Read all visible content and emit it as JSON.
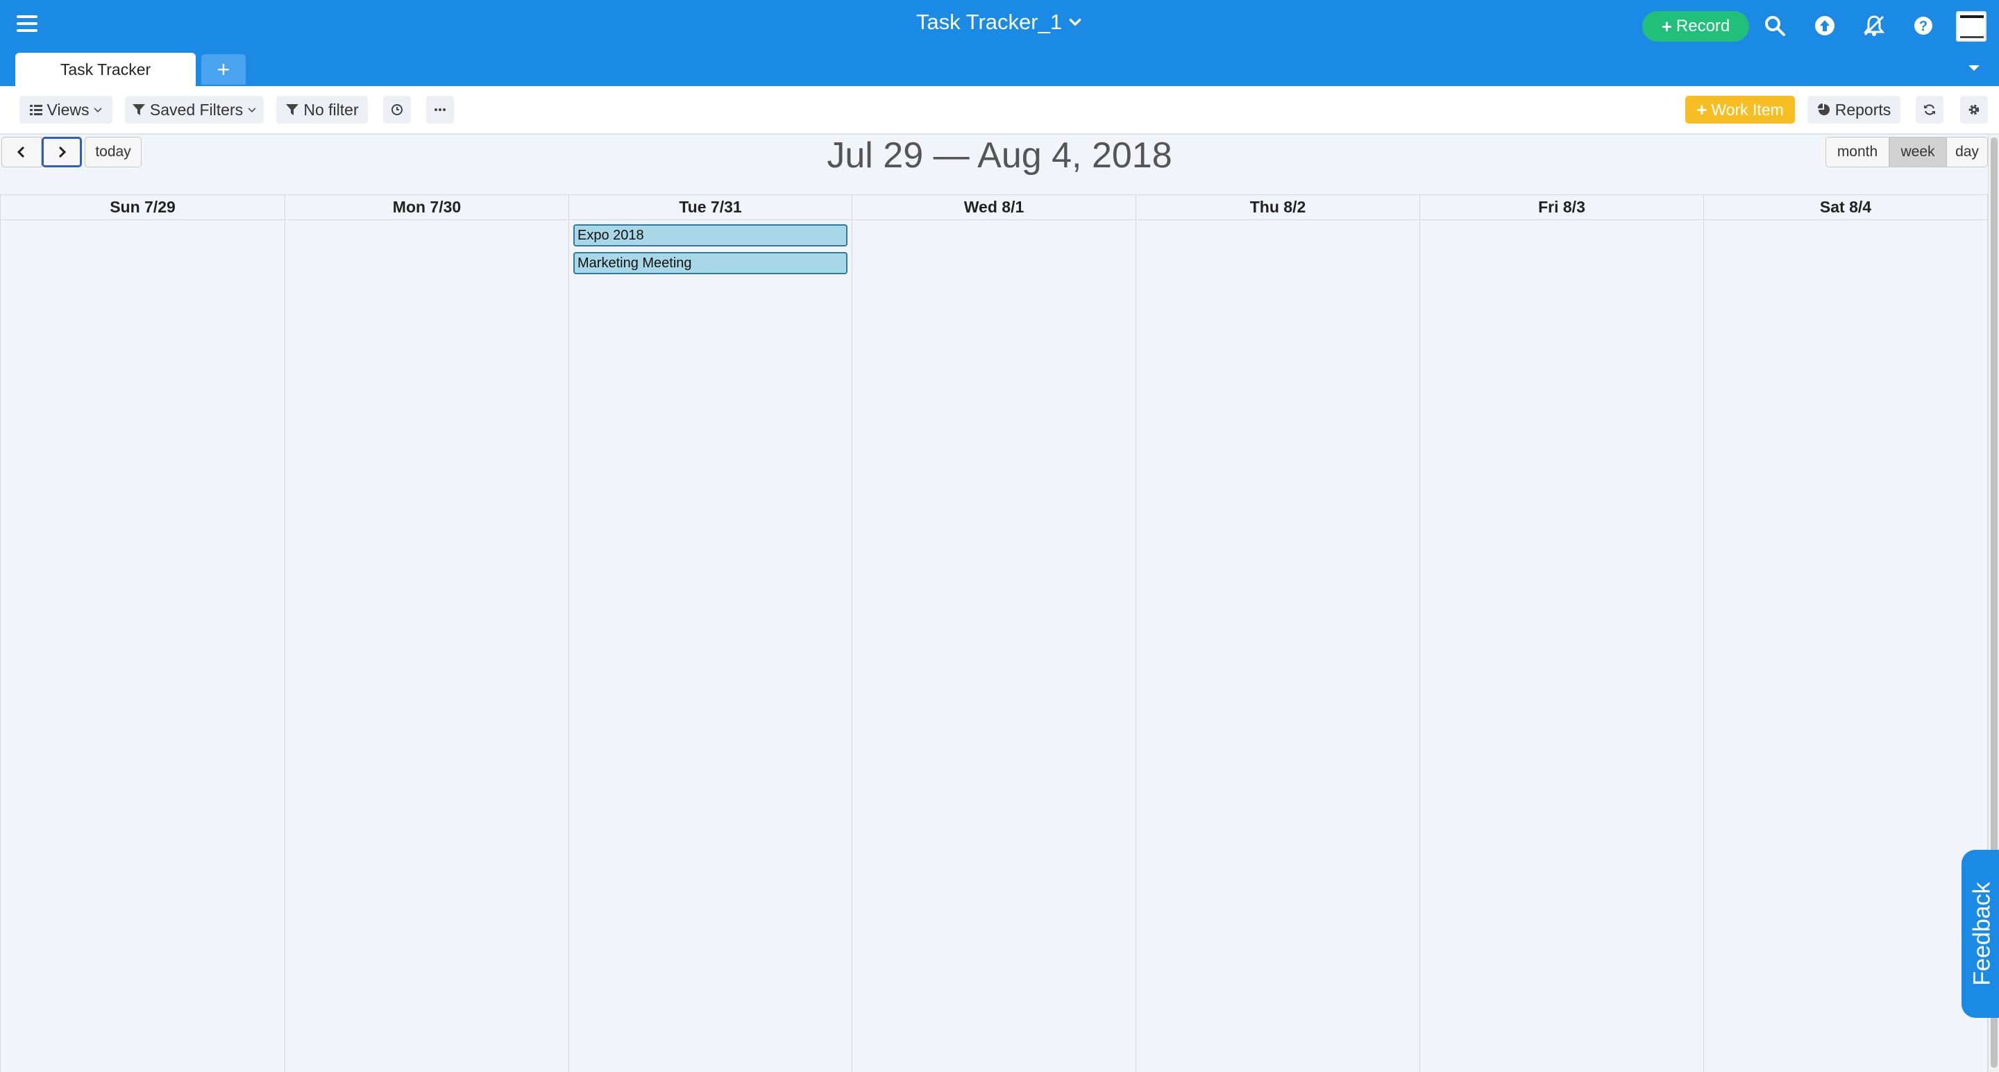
{
  "header": {
    "app_title": "Task Tracker_1",
    "record_label": "Record",
    "icons": [
      "menu-icon",
      "search-icon",
      "upload-icon",
      "notifications-off-icon",
      "help-icon",
      "avatar"
    ]
  },
  "tabs": [
    {
      "label": "Task Tracker",
      "active": true
    }
  ],
  "toolbar": {
    "views_label": "Views",
    "saved_filters_label": "Saved Filters",
    "no_filter_label": "No filter",
    "work_item_label": "Work Item",
    "reports_label": "Reports"
  },
  "calendar": {
    "range_title": "Jul 29 — Aug 4, 2018",
    "today_label": "today",
    "view_options": [
      "month",
      "week",
      "day"
    ],
    "active_view": "week",
    "days": [
      {
        "label": "Sun 7/29",
        "events": []
      },
      {
        "label": "Mon 7/30",
        "events": []
      },
      {
        "label": "Tue 7/31",
        "events": [
          "Expo 2018",
          "Marketing Meeting"
        ]
      },
      {
        "label": "Wed 8/1",
        "events": []
      },
      {
        "label": "Thu 8/2",
        "events": []
      },
      {
        "label": "Fri 8/3",
        "events": []
      },
      {
        "label": "Sat 8/4",
        "events": []
      }
    ]
  },
  "feedback_label": "Feedback",
  "colors": {
    "header_blue": "#1a8ae5",
    "record_green": "#21c07a",
    "work_item_yellow": "#f7be23",
    "event_fill": "#a8d8e8",
    "event_border": "#2f79a4"
  }
}
